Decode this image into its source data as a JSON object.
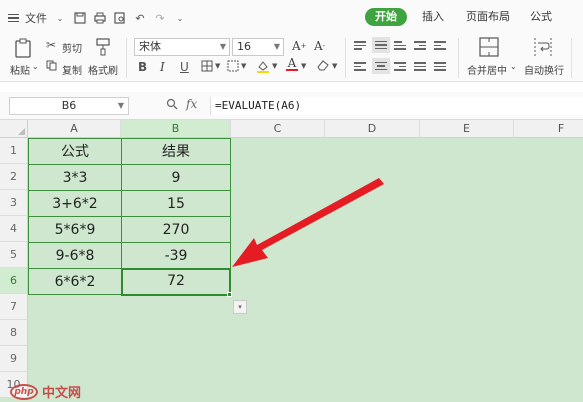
{
  "menu": {
    "file_label": "文件",
    "tabs": [
      {
        "label": "开始",
        "active": true
      },
      {
        "label": "插入",
        "active": false
      },
      {
        "label": "页面布局",
        "active": false
      },
      {
        "label": "公式",
        "active": false
      }
    ]
  },
  "ribbon": {
    "paste_label": "粘贴",
    "cut_label": "剪切",
    "copy_label": "复制",
    "format_painter_label": "格式刷",
    "font_name": "宋体",
    "font_size": "16",
    "merge_center_label": "合并居中",
    "wrap_text_label": "自动换行"
  },
  "formula_bar": {
    "name_box": "B6",
    "fx_label": "fx",
    "formula": "=EVALUATE(A6)"
  },
  "sheet": {
    "columns": [
      "A",
      "B",
      "C",
      "D",
      "E",
      "F"
    ],
    "rows": [
      "1",
      "2",
      "3",
      "4",
      "5",
      "6",
      "7",
      "8",
      "9",
      "10"
    ],
    "selected_cell": "B6",
    "table": [
      {
        "a": "公式",
        "b": "结果"
      },
      {
        "a": "3*3",
        "b": "9"
      },
      {
        "a": "3+6*2",
        "b": "15"
      },
      {
        "a": "5*6*9",
        "b": "270"
      },
      {
        "a": "9-6*8",
        "b": "-39"
      },
      {
        "a": "6*6*2",
        "b": "72"
      }
    ]
  },
  "colors": {
    "accent": "#3fa33f",
    "sheet_bg": "#cfe7cf",
    "arrow": "#e51c23"
  },
  "watermark": {
    "logo": "php",
    "text": "中文网"
  }
}
